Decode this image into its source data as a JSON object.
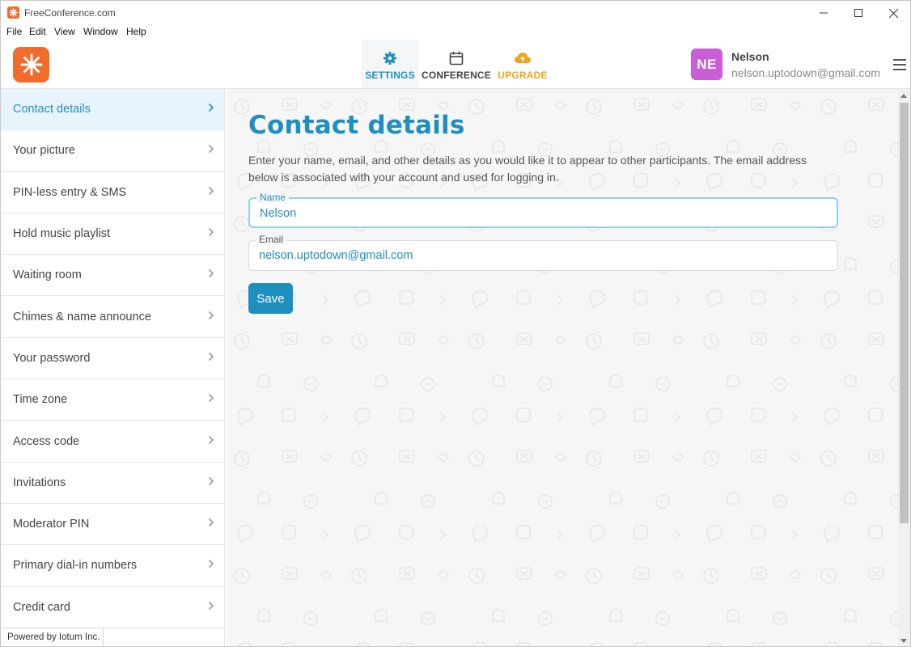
{
  "window": {
    "title": "FreeConference.com",
    "controls": [
      "—",
      "☐",
      "✕"
    ]
  },
  "menubar": [
    "File",
    "Edit",
    "View",
    "Window",
    "Help"
  ],
  "header": {
    "nav": [
      {
        "label": "SETTINGS",
        "icon": "gear-icon",
        "active": true
      },
      {
        "label": "CONFERENCE",
        "icon": "calendar-icon",
        "active": false
      },
      {
        "label": "UPGRADE",
        "icon": "cloud-upload-icon",
        "active": false
      }
    ],
    "user": {
      "initials": "NE",
      "name": "Nelson",
      "email": "nelson.uptodown@gmail.com"
    }
  },
  "sidebar": {
    "items": [
      {
        "label": "Contact details",
        "active": true
      },
      {
        "label": "Your picture"
      },
      {
        "label": "PIN-less entry & SMS"
      },
      {
        "label": "Hold music playlist"
      },
      {
        "label": "Waiting room"
      },
      {
        "label": "Chimes & name announce"
      },
      {
        "label": "Your password"
      },
      {
        "label": "Time zone"
      },
      {
        "label": "Access code"
      },
      {
        "label": "Invitations"
      },
      {
        "label": "Moderator PIN"
      },
      {
        "label": "Primary dial-in numbers"
      },
      {
        "label": "Credit card"
      }
    ],
    "powered_by": "Powered by Iotum Inc."
  },
  "main": {
    "title": "Contact details",
    "description": "Enter your name, email, and other details as you would like it to appear to other participants. The email address below is associated with your account and used for logging in.",
    "fields": {
      "name": {
        "label": "Name",
        "value": "Nelson"
      },
      "email": {
        "label": "Email",
        "value": "nelson.uptodown@gmail.com"
      }
    },
    "save_label": "Save"
  },
  "colors": {
    "accent": "#1f8fbf",
    "brand": "#f26b2a",
    "upgrade": "#f0a31d",
    "avatar": "#c85fd6"
  }
}
